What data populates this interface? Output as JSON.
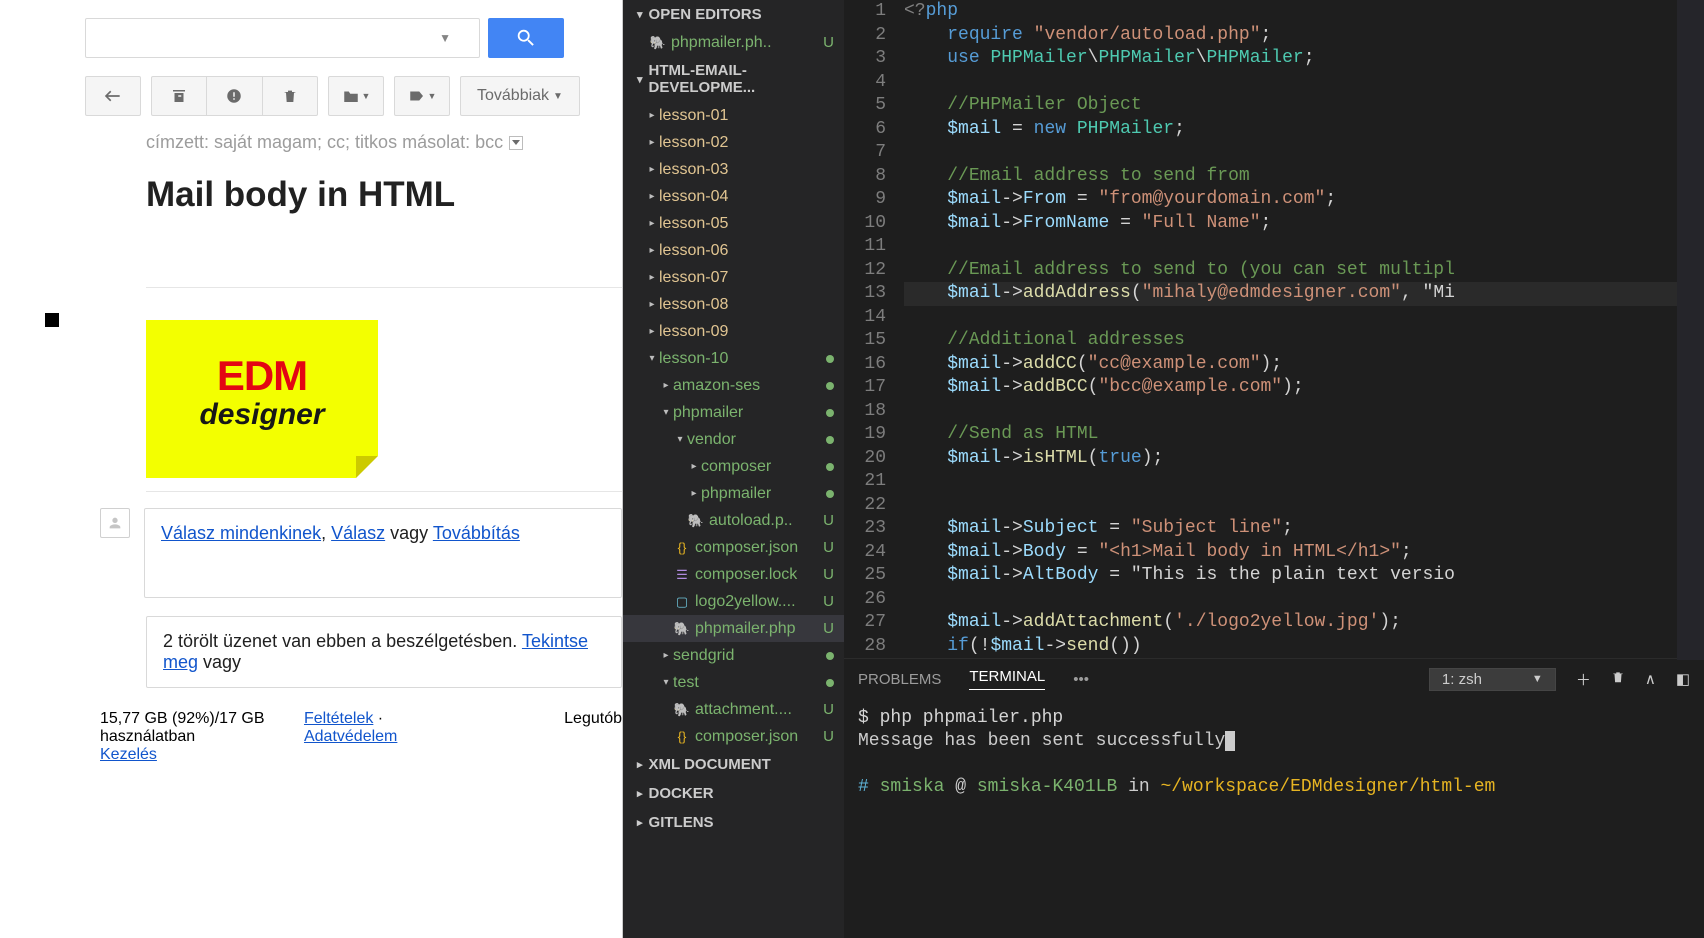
{
  "gmail": {
    "search_placeholder": "",
    "more_label": "Továbbiak",
    "recipients": "címzett: saját magam; cc; titkos másolat: bcc",
    "subject": "Mail body in HTML",
    "logo_top": "EDM",
    "logo_bottom": "designer",
    "reply_all": "Válasz mindenkinek",
    "reply": "Válasz",
    "or": " vagy ",
    "forward": "Továbbítás",
    "deleted_prefix": "2 törölt üzenet van ebben a beszélgetésben. ",
    "deleted_link": "Tekintse meg",
    "deleted_suffix": " vagy",
    "storage": "15,77 GB (92%)/17 GB használatban",
    "manage": "Kezelés",
    "terms": "Feltételek",
    "sep": " · ",
    "privacy": "Adatvédelem",
    "last": "Legutób"
  },
  "explorer": {
    "open_editors": "OPEN EDITORS",
    "open_file": "phpmailer.ph..",
    "project": "HTML-EMAIL-DEVELOPME...",
    "lessons": [
      "lesson-01",
      "lesson-02",
      "lesson-03",
      "lesson-04",
      "lesson-05",
      "lesson-06",
      "lesson-07",
      "lesson-08",
      "lesson-09"
    ],
    "lesson10": "lesson-10",
    "amazon": "amazon-ses",
    "phpmailer_dir": "phpmailer",
    "vendor": "vendor",
    "composer_dir": "composer",
    "phpmailer_sub": "phpmailer",
    "autoload": "autoload.p..",
    "comp_json": "composer.json",
    "comp_lock": "composer.lock",
    "logo": "logo2yellow....",
    "phpmailer_file": "phpmailer.php",
    "sendgrid": "sendgrid",
    "test": "test",
    "attachment": "attachment....",
    "comp_json2": "composer.json",
    "xml": "XML DOCUMENT",
    "docker": "DOCKER",
    "gitlens": "GITLENS"
  },
  "code": {
    "lines": [
      "<?php",
      "    require \"vendor/autoload.php\";",
      "    use PHPMailer\\PHPMailer\\PHPMailer;",
      "",
      "    //PHPMailer Object",
      "    $mail = new PHPMailer;",
      "",
      "    //Email address to send from",
      "    $mail->From = \"from@yourdomain.com\";",
      "    $mail->FromName = \"Full Name\";",
      "",
      "    //Email address to send to (you can set multipl",
      "    $mail->addAddress(\"mihaly@edmdesigner.com\", \"Mi",
      "",
      "    //Additional addresses",
      "    $mail->addCC(\"cc@example.com\");",
      "    $mail->addBCC(\"bcc@example.com\");",
      "",
      "    //Send as HTML",
      "    $mail->isHTML(true);",
      "",
      "",
      "    $mail->Subject = \"Subject line\";",
      "    $mail->Body = \"<h1>Mail body in HTML</h1>\";",
      "    $mail->AltBody = \"This is the plain text versio",
      "",
      "    $mail->addAttachment('./logo2yellow.jpg');",
      "    if(!$mail->send())"
    ]
  },
  "terminal": {
    "problems": "PROBLEMS",
    "terminal": "TERMINAL",
    "shell": "1: zsh",
    "cmd": "$ php phpmailer.php",
    "out": "Message has been sent successfully",
    "prompt_hash": "# ",
    "prompt_user": "smiska",
    "prompt_at": " @ ",
    "prompt_host": "smiska-K401LB",
    "prompt_in": " in ",
    "prompt_path": "~/workspace/EDMdesigner/html-em"
  }
}
